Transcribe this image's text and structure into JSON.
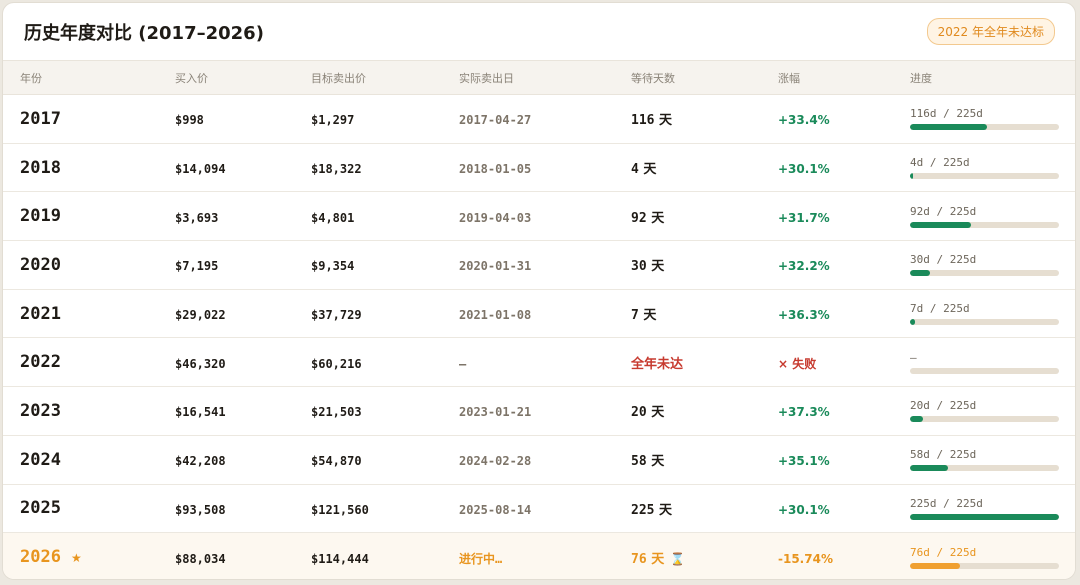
{
  "header": {
    "title": "历史年度对比 (2017–2026)",
    "badge": "2022 年全年未达标"
  },
  "columns": [
    "年份",
    "买入价",
    "目标卖出价",
    "实际卖出日",
    "等待天数",
    "涨幅",
    "进度"
  ],
  "rows": [
    {
      "year": "2017",
      "buy": "$998",
      "target": "$1,297",
      "sold": "2017-04-27",
      "days": "116",
      "unit": "天",
      "gain": "+33.4%",
      "progress_label": "116d / 225d",
      "progress": 0.516
    },
    {
      "year": "2018",
      "buy": "$14,094",
      "target": "$18,322",
      "sold": "2018-01-05",
      "days": "4",
      "unit": "天",
      "gain": "+30.1%",
      "progress_label": "4d / 225d",
      "progress": 0.018
    },
    {
      "year": "2019",
      "buy": "$3,693",
      "target": "$4,801",
      "sold": "2019-04-03",
      "days": "92",
      "unit": "天",
      "gain": "+31.7%",
      "progress_label": "92d / 225d",
      "progress": 0.409
    },
    {
      "year": "2020",
      "buy": "$7,195",
      "target": "$9,354",
      "sold": "2020-01-31",
      "days": "30",
      "unit": "天",
      "gain": "+32.2%",
      "progress_label": "30d / 225d",
      "progress": 0.133
    },
    {
      "year": "2021",
      "buy": "$29,022",
      "target": "$37,729",
      "sold": "2021-01-08",
      "days": "7",
      "unit": "天",
      "gain": "+36.3%",
      "progress_label": "7d / 225d",
      "progress": 0.031
    },
    {
      "year": "2022",
      "buy": "$46,320",
      "target": "$60,216",
      "sold": "—",
      "days_text": "全年未达",
      "gain_fail": "× 失败",
      "progress_label": "—",
      "progress": 0
    },
    {
      "year": "2023",
      "buy": "$16,541",
      "target": "$21,503",
      "sold": "2023-01-21",
      "days": "20",
      "unit": "天",
      "gain": "+37.3%",
      "progress_label": "20d / 225d",
      "progress": 0.089
    },
    {
      "year": "2024",
      "buy": "$42,208",
      "target": "$54,870",
      "sold": "2024-02-28",
      "days": "58",
      "unit": "天",
      "gain": "+35.1%",
      "progress_label": "58d / 225d",
      "progress": 0.258
    },
    {
      "year": "2025",
      "buy": "$93,508",
      "target": "$121,560",
      "sold": "2025-08-14",
      "days": "225",
      "unit": "天",
      "gain": "+30.1%",
      "progress_label": "225d / 225d",
      "progress": 1.0
    },
    {
      "year": "2026",
      "star": "★",
      "buy": "$88,034",
      "target": "$114,444",
      "sold": "进行中…",
      "days": "76",
      "unit": "天",
      "hourglass": "⌛",
      "gain": "-15.74%",
      "progress_label": "76d / 225d",
      "progress": 0.338
    }
  ],
  "colors": {
    "accent": "#e8951f",
    "positive": "#1a8a5a",
    "negative": "#c73a2f"
  }
}
